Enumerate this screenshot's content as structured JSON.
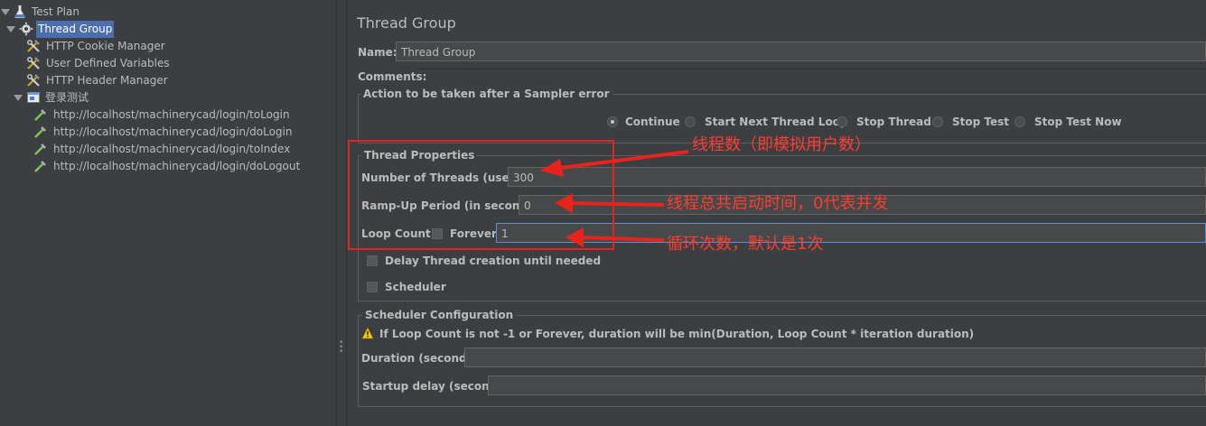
{
  "tree": {
    "items": [
      {
        "label": "Test Plan",
        "icon": "flask-icon"
      },
      {
        "label": "Thread Group",
        "icon": "gear-icon",
        "selected": true
      },
      {
        "label": "HTTP Cookie Manager",
        "icon": "wrench-screwdriver-icon"
      },
      {
        "label": "User Defined Variables",
        "icon": "wrench-screwdriver-icon"
      },
      {
        "label": "HTTP Header Manager",
        "icon": "wrench-screwdriver-icon"
      },
      {
        "label": "登录测试",
        "icon": "controller-icon"
      },
      {
        "label": "http://localhost/machinerycad/login/toLogin",
        "icon": "pipette-icon"
      },
      {
        "label": "http://localhost/machinerycad/login/doLogin",
        "icon": "pipette-icon"
      },
      {
        "label": "http://localhost/machinerycad/login/toIndex",
        "icon": "pipette-icon"
      },
      {
        "label": "http://localhost/machinerycad/login/doLogout",
        "icon": "pipette-icon"
      }
    ]
  },
  "panel": {
    "title": "Thread Group",
    "name_label": "Name:",
    "name_value": "Thread Group",
    "comments_label": "Comments:",
    "sampler_error": {
      "title": "Action to be taken after a Sampler error",
      "options": [
        "Continue",
        "Start Next Thread Loop",
        "Stop Thread",
        "Stop Test",
        "Stop Test Now"
      ],
      "selected": "Continue"
    },
    "thread_properties": {
      "title": "Thread Properties",
      "threads_label": "Number of Threads (users):",
      "threads_value": "300",
      "rampup_label": "Ramp-Up Period (in seconds):",
      "rampup_value": "0",
      "loop_label": "Loop Count:",
      "forever_label": "Forever",
      "loop_value": "1",
      "forever_checked": false
    },
    "delay_label": "Delay Thread creation until needed",
    "scheduler_label": "Scheduler",
    "scheduler_config": {
      "title": "Scheduler Configuration",
      "warning": "If Loop Count is not -1 or Forever, duration will be min(Duration, Loop Count * iteration duration)",
      "duration_label": "Duration (seconds)",
      "startup_label": "Startup delay (seconds)"
    }
  },
  "annotations": {
    "threads": "线程数（即模拟用户数）",
    "rampup": "线程总共启动时间，0代表并发",
    "loop": "循环次数，默认是1次",
    "color": "#ff3b30"
  }
}
